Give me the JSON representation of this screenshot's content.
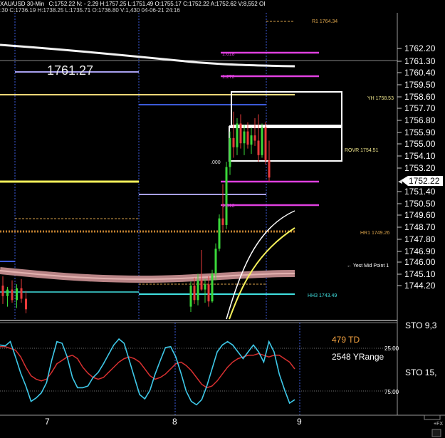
{
  "chart_data": {
    "type": "candlestick",
    "header": {
      "symbol_line": "XAU/USD 30-Min",
      "stats": "C:1752.22  N: - 2.29  H:1757.25  L:1751.49  O:1755.17  C:1752.22  A:1752.62  V:8,552  OI",
      "second_line": ":30  C:1736.19  H:1738.25  L:1735.71  O:1736.80  V:1,430  04-06-21  24:16"
    },
    "price_axis": {
      "ylim": [
        1741.6,
        1766.2
      ],
      "ticks": [
        "1762.20",
        "1761.30",
        "1760.40",
        "1759.50",
        "1758.60",
        "1757.70",
        "1756.80",
        "1755.90",
        "1755.00",
        "1754.10",
        "1753.20",
        "1751.40",
        "1750.50",
        "1749.60",
        "1748.70",
        "1747.80",
        "1746.90",
        "1746.00",
        "1745.10",
        "1744.20"
      ],
      "current_price": "1752.22"
    },
    "date_axis": [
      "7",
      "8",
      "9"
    ],
    "big_label": "1761.27",
    "level_labels": [
      {
        "text": "R1 1764.34",
        "price": 1764.34,
        "color": "#d9a24a"
      },
      {
        "text": "1.618",
        "price": 1761.85,
        "color": "#e040e0"
      },
      {
        "text": "1.272",
        "price": 1760.2,
        "color": "#e040e0"
      },
      {
        "text": "YH 1758.53",
        "price": 1758.53,
        "color": "#f0e68c"
      },
      {
        "text": "ROVR 1754.51",
        "price": 1754.51,
        "color": "#f0e68c"
      },
      {
        "text": ".000",
        "price": 1753.9,
        "color": "#e0e0e0"
      },
      {
        "text": "1.618",
        "price": 1750.5,
        "color": "#e040e0"
      },
      {
        "text": "HR1 1749.26",
        "price": 1748.9,
        "color": "#d9a24a"
      },
      {
        "text": "← Yest Mid Point 1",
        "price": 1746.9,
        "color": "#ffffff"
      },
      {
        "text": "HH3 1743.49",
        "price": 1743.49,
        "color": "#40e0e0"
      }
    ],
    "candles": [
      {
        "t": 0,
        "o": 1744.2,
        "h": 1744.9,
        "l": 1742.8,
        "c": 1743.4
      },
      {
        "t": 1,
        "o": 1743.4,
        "h": 1744.1,
        "l": 1742.6,
        "c": 1743.9
      },
      {
        "t": 2,
        "o": 1743.9,
        "h": 1744.6,
        "l": 1742.9,
        "c": 1743.1
      },
      {
        "t": 3,
        "o": 1743.1,
        "h": 1744.3,
        "l": 1742.5,
        "c": 1744.0
      },
      {
        "t": 4,
        "o": 1744.0,
        "h": 1744.7,
        "l": 1742.9,
        "c": 1743.2
      },
      {
        "t": 5,
        "o": 1743.2,
        "h": 1743.8,
        "l": 1742.1,
        "c": 1742.4
      },
      {
        "t": 60,
        "o": 1742.6,
        "h": 1744.5,
        "l": 1742.2,
        "c": 1744.2
      },
      {
        "t": 61,
        "o": 1744.2,
        "h": 1744.8,
        "l": 1742.8,
        "c": 1743.1
      },
      {
        "t": 62,
        "o": 1743.1,
        "h": 1745.1,
        "l": 1742.7,
        "c": 1744.6
      },
      {
        "t": 63,
        "o": 1744.6,
        "h": 1746.9,
        "l": 1743.8,
        "c": 1743.9
      },
      {
        "t": 64,
        "o": 1743.9,
        "h": 1744.7,
        "l": 1742.9,
        "c": 1744.3
      },
      {
        "t": 65,
        "o": 1744.3,
        "h": 1744.9,
        "l": 1742.6,
        "c": 1743.0
      },
      {
        "t": 66,
        "o": 1743.0,
        "h": 1745.4,
        "l": 1742.9,
        "c": 1745.1
      },
      {
        "t": 67,
        "o": 1745.1,
        "h": 1747.4,
        "l": 1744.6,
        "c": 1747.0
      },
      {
        "t": 68,
        "o": 1747.0,
        "h": 1749.6,
        "l": 1746.8,
        "c": 1749.3
      },
      {
        "t": 69,
        "o": 1749.3,
        "h": 1751.9,
        "l": 1748.4,
        "c": 1748.8
      },
      {
        "t": 70,
        "o": 1748.8,
        "h": 1753.6,
        "l": 1748.5,
        "c": 1753.2
      },
      {
        "t": 71,
        "o": 1753.2,
        "h": 1755.9,
        "l": 1752.6,
        "c": 1755.4
      },
      {
        "t": 72,
        "o": 1755.4,
        "h": 1757.4,
        "l": 1753.9,
        "c": 1754.7
      },
      {
        "t": 73,
        "o": 1754.7,
        "h": 1756.9,
        "l": 1754.1,
        "c": 1756.5
      },
      {
        "t": 74,
        "o": 1756.5,
        "h": 1757.2,
        "l": 1754.6,
        "c": 1755.0
      },
      {
        "t": 75,
        "o": 1755.0,
        "h": 1756.4,
        "l": 1754.1,
        "c": 1755.9
      },
      {
        "t": 76,
        "o": 1755.9,
        "h": 1756.6,
        "l": 1754.6,
        "c": 1754.9
      },
      {
        "t": 77,
        "o": 1754.9,
        "h": 1756.2,
        "l": 1754.2,
        "c": 1755.6
      },
      {
        "t": 78,
        "o": 1755.6,
        "h": 1756.9,
        "l": 1754.8,
        "c": 1755.2
      },
      {
        "t": 79,
        "o": 1755.2,
        "h": 1757.2,
        "l": 1753.6,
        "c": 1754.1
      },
      {
        "t": 80,
        "o": 1754.1,
        "h": 1756.5,
        "l": 1753.9,
        "c": 1756.2
      },
      {
        "t": 81,
        "o": 1756.2,
        "h": 1756.6,
        "l": 1753.4,
        "c": 1753.7
      },
      {
        "t": 82,
        "o": 1753.7,
        "h": 1755.2,
        "l": 1752.1,
        "c": 1752.4
      }
    ],
    "indicator": {
      "labels": {
        "top_right": "STO 9,3",
        "mid_right": "STO 15,",
        "td": "479 TD",
        "yrange": "2548 YRange"
      },
      "ticks": [
        "25.00",
        "75.00"
      ],
      "fast": [
        22,
        23,
        18,
        36,
        55,
        70,
        88,
        84,
        78,
        66,
        40,
        18,
        20,
        36,
        60,
        72,
        72,
        70,
        60,
        54,
        44,
        33,
        22,
        15,
        20,
        40,
        60,
        80,
        85,
        75,
        56,
        40,
        25,
        24,
        36,
        55,
        76,
        88,
        92,
        86,
        70,
        50,
        30,
        22,
        18,
        22,
        30,
        38,
        30,
        22,
        30,
        42,
        18,
        30,
        56,
        74,
        90,
        86
      ],
      "slow": [
        24,
        24,
        26,
        28,
        36,
        48,
        58,
        62,
        64,
        62,
        54,
        44,
        40,
        36,
        34,
        38,
        48,
        55,
        60,
        62,
        60,
        54,
        48,
        42,
        38,
        36,
        38,
        42,
        50,
        58,
        62,
        60,
        56,
        50,
        44,
        42,
        46,
        52,
        60,
        68,
        72,
        70,
        64,
        56,
        48,
        42,
        38,
        36,
        34,
        34,
        32,
        34,
        36,
        34,
        34,
        38,
        42,
        50
      ]
    }
  }
}
